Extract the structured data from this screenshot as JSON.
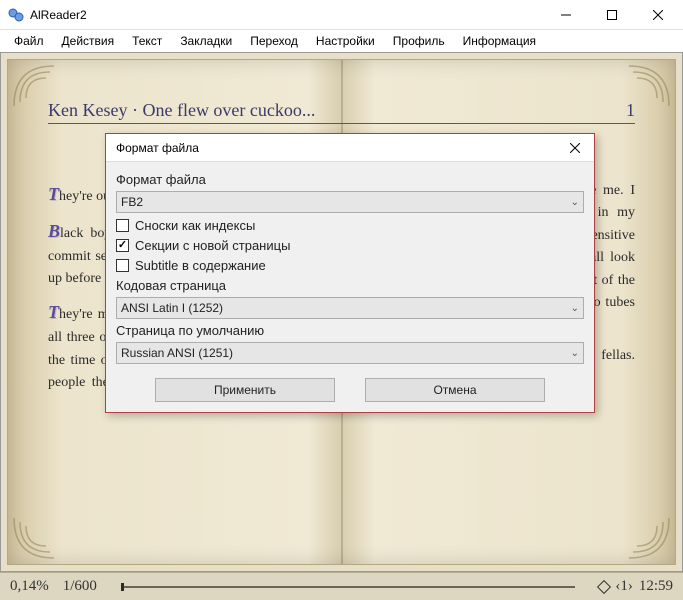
{
  "window": {
    "title": "AlReader2"
  },
  "menu": {
    "items": [
      "Файл",
      "Действия",
      "Текст",
      "Закладки",
      "Переход",
      "Настройки",
      "Профиль",
      "Информация"
    ]
  },
  "header": {
    "author_title": "Ken Kesey  · One flew over cuckoo...",
    "page_no": "1"
  },
  "book": {
    "left_page": "They're out there.\nBlack boys in white suits up before me to commit sex acts in the hall and get it mopped up before I can catch them.\nThey're mopping when I come out the dorm, all three of them sulky and hating",
    "right_page": "everything, the time of day, the place they're at here, the people they got to work around. When they hate like this, better if they don't see me. I creep along the wall quiet as dust in my canvas shoes, but they got special sensitive equipment detects my fear and they all look up, all three at once, eyes glittering out of the black faces like the hard glitter of radio tubes out of the back of an old radio.\n\"Here's the Chief. The soo-pah Chief, fellas. Ol' Chief"
  },
  "dialog": {
    "title": "Формат файла",
    "section1": "Формат файла",
    "format": "FB2",
    "checkbox1": {
      "label": "Сноски как индексы",
      "checked": false
    },
    "checkbox2": {
      "label": "Секции с новой страницы",
      "checked": true
    },
    "checkbox3": {
      "label": "Subtitle в содержание",
      "checked": false
    },
    "section2": "Кодовая страница",
    "codepage": "ANSI Latin I (1252)",
    "section3": "Страница по умолчанию",
    "defaultpage": "Russian ANSI (1251)",
    "apply": "Применить",
    "cancel": "Отмена"
  },
  "status": {
    "percent": "0,14%",
    "page": "1/600",
    "right_val": "‹1›",
    "time": "12:59"
  }
}
